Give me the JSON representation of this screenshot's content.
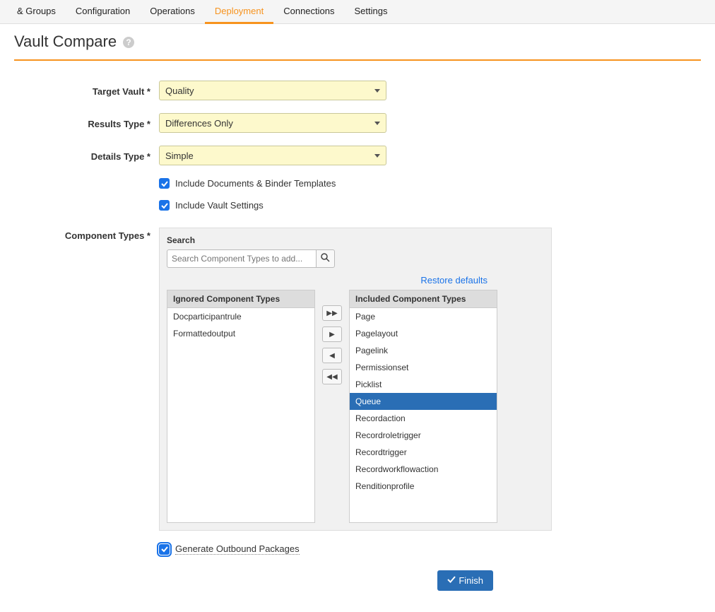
{
  "tabs": {
    "items": [
      "& Groups",
      "Configuration",
      "Operations",
      "Deployment",
      "Connections",
      "Settings"
    ],
    "active_index": 3
  },
  "page_title": "Vault Compare",
  "form": {
    "target_vault": {
      "label": "Target Vault *",
      "value": "Quality"
    },
    "results_type": {
      "label": "Results Type *",
      "value": "Differences Only"
    },
    "details_type": {
      "label": "Details Type *",
      "value": "Simple"
    },
    "include_docs": {
      "label": "Include Documents & Binder Templates",
      "checked": true
    },
    "include_settings": {
      "label": "Include Vault Settings",
      "checked": true
    }
  },
  "component_types": {
    "label": "Component Types *",
    "search_label": "Search",
    "search_placeholder": "Search Component Types to add...",
    "restore_label": "Restore defaults",
    "ignored_header": "Ignored Component Types",
    "included_header": "Included Component Types",
    "ignored_items": [
      "Docparticipantrule",
      "Formattedoutput"
    ],
    "included_items": [
      "Page",
      "Pagelayout",
      "Pagelink",
      "Permissionset",
      "Picklist",
      "Queue",
      "Recordaction",
      "Recordroletrigger",
      "Recordtrigger",
      "Recordworkflowaction",
      "Renditionprofile"
    ],
    "selected_included_index": 5
  },
  "generate_packages": {
    "label": "Generate Outbound Packages",
    "checked": true
  },
  "finish_label": "Finish"
}
